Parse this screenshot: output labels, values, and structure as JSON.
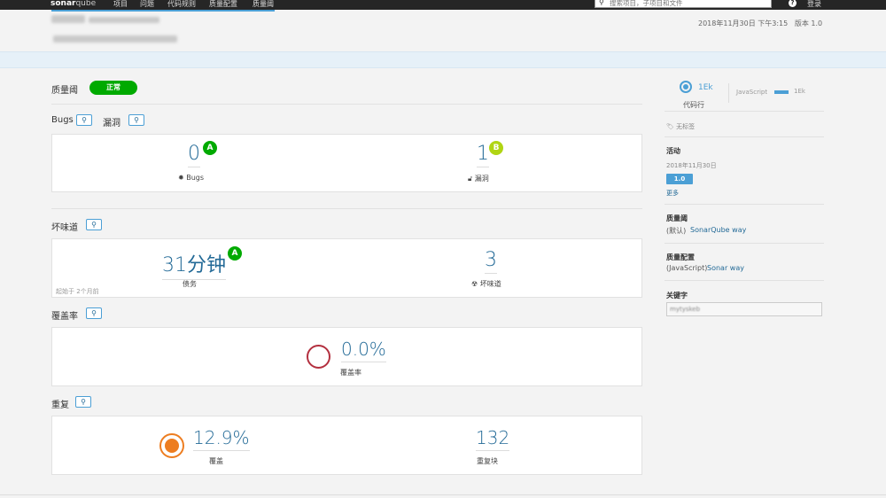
{
  "nav": {
    "logo_bold": "sonar",
    "logo_light": "qube",
    "items": [
      "项目",
      "问题",
      "代码规则",
      "质量配置",
      "质量阈"
    ],
    "search_placeholder": "搜索项目，子项目和文件",
    "login": "登录"
  },
  "project": {
    "date": "2018年11月30日 下午3:15",
    "version": "版本 1.0"
  },
  "quality_gate": {
    "label": "质量阈",
    "status": "正常",
    "status_color": "#00aa00"
  },
  "reliability": {
    "bugs_label": "Bugs",
    "vuln_label": "漏洞",
    "bugs_value": "0",
    "bugs_rating": "A",
    "bugs_caption": "Bugs",
    "vuln_value": "1",
    "vuln_rating": "B",
    "vuln_caption": "漏洞"
  },
  "maintainability": {
    "label": "坏味道",
    "debt_value": "31分钟",
    "debt_rating": "A",
    "debt_caption": "债务",
    "since": "起始于 2个月前",
    "smells_value": "3",
    "smells_caption": "坏味道"
  },
  "coverage": {
    "label": "覆盖率",
    "value": "0.0%",
    "caption": "覆盖率"
  },
  "duplications": {
    "label": "重复",
    "value": "12.9%",
    "caption": "覆盖",
    "blocks_value": "132",
    "blocks_caption": "重复块"
  },
  "sidebar": {
    "loc_value": "1Ek",
    "loc_caption": "代码行",
    "lang_name": "JavaScript",
    "lang_value": "1Ek",
    "tags": "无标签",
    "activity_title": "活动",
    "activity_date": "2018年11月30日",
    "activity_version": "1.0",
    "activity_more": "更多",
    "qg_title": "质量阈",
    "qg_default": "(默认)",
    "qg_link": "SonarQube way",
    "qp_title": "质量配置",
    "qp_lang": "(JavaScript)",
    "qp_link": "Sonar way",
    "keyword_title": "关键字",
    "keyword_value": "mytyskeb"
  },
  "colors": {
    "rating_a": "#00aa00",
    "rating_b": "#b0d513",
    "accent": "#4b9fd5",
    "link": "#236a97",
    "coverage_ring": "#b3303f",
    "duplication_ring": "#ed7d20"
  }
}
